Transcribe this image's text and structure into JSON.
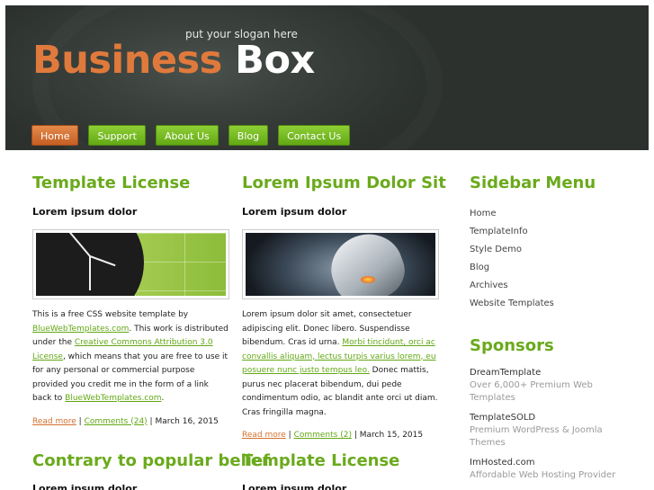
{
  "header": {
    "slogan": "put your slogan here",
    "logo_part1": "Business",
    "logo_part2": "Box",
    "nav": [
      {
        "label": "Home",
        "active": true
      },
      {
        "label": "Support"
      },
      {
        "label": "About Us"
      },
      {
        "label": "Blog"
      },
      {
        "label": "Contact Us"
      }
    ]
  },
  "posts": [
    {
      "title": "Template License",
      "subtitle": "Lorem ipsum dolor",
      "image": "clock-image",
      "body": [
        {
          "text": "This is a free CSS website template by "
        },
        {
          "link": "BlueWebTemplates.com"
        },
        {
          "text": ". This work is distributed under the "
        },
        {
          "link": "Creative Commons Attribution 3.0 License"
        },
        {
          "text": ", which means that you are free to use it for any personal or commercial purpose provided you credit me in the form of a link back to "
        },
        {
          "link": "BlueWebTemplates.com"
        },
        {
          "text": "."
        }
      ],
      "read_more": "Read more",
      "comments": "Comments (24)",
      "date": "March 16, 2015"
    },
    {
      "title": "Lorem Ipsum Dolor Sit",
      "subtitle": "Lorem ipsum dolor",
      "image": "mouse-image",
      "body": [
        {
          "text": "Lorem ipsum dolor sit amet, consectetuer adipiscing elit. Donec libero. Suspendisse bibendum. Cras id urna. "
        },
        {
          "link": "Morbi tincidunt, orci ac convallis aliquam, lectus turpis varius lorem, eu posuere nunc justo tempus leo."
        },
        {
          "text": " Donec mattis, purus nec placerat bibendum, dui pede condimentum odio, ac blandit ante orci ut diam. Cras fringilla magna."
        }
      ],
      "read_more": "Read more",
      "comments": "Comments (2)",
      "date": "March 15, 2015"
    },
    {
      "title": "Contrary to popular belief",
      "subtitle": "Lorem ipsum dolor"
    },
    {
      "title": "Template License",
      "subtitle": "Lorem ipsum dolor"
    }
  ],
  "sidebar": {
    "menu_title": "Sidebar Menu",
    "menu": [
      "Home",
      "TemplateInfo",
      "Style Demo",
      "Blog",
      "Archives",
      "Website Templates"
    ],
    "sponsors_title": "Sponsors",
    "sponsors": [
      {
        "name": "DreamTemplate",
        "desc": "Over 6,000+ Premium Web Templates"
      },
      {
        "name": "TemplateSOLD",
        "desc": "Premium WordPress & Joomla Themes"
      },
      {
        "name": "ImHosted.com",
        "desc": "Affordable Web Hosting Provider"
      }
    ]
  },
  "colors": {
    "accent_green": "#6aaa1c",
    "accent_orange": "#e07a3c",
    "header_bg": "#2c312e"
  }
}
